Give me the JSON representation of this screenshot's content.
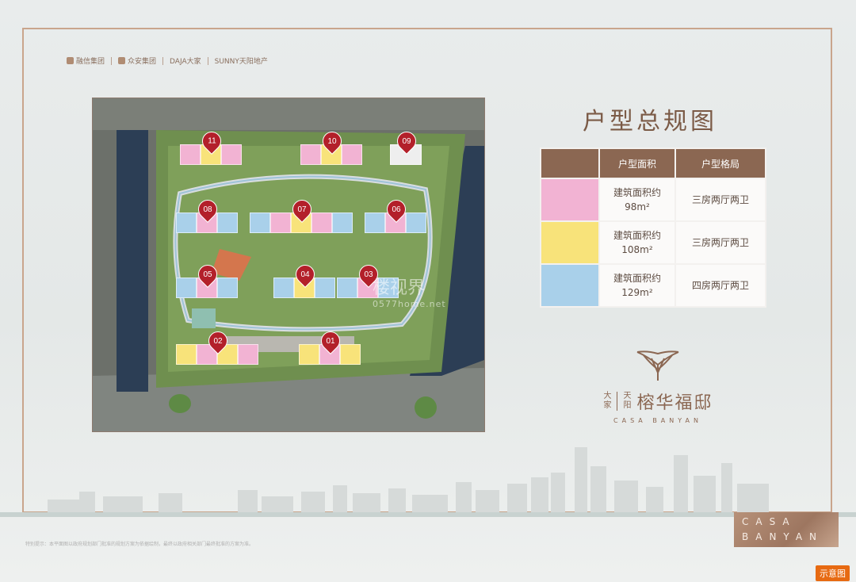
{
  "brands": [
    "融信集团",
    "众安集团",
    "DAJA大家",
    "SUNNY天阳地产"
  ],
  "title": "户型总规图",
  "table": {
    "headers": [
      "",
      "户型面积",
      "户型格局"
    ],
    "rows": [
      {
        "swatch_color": "#f2b3d3",
        "area_label": "建筑面积约",
        "area_value": "98m²",
        "layout": "三房两厅两卫"
      },
      {
        "swatch_color": "#f8e37a",
        "area_label": "建筑面积约",
        "area_value": "108m²",
        "layout": "三房两厅两卫"
      },
      {
        "swatch_color": "#a9d0ea",
        "area_label": "建筑面积约",
        "area_value": "129m²",
        "layout": "四房两厅两卫"
      }
    ]
  },
  "buildings": [
    "11",
    "10",
    "09",
    "08",
    "07",
    "06",
    "05",
    "04",
    "03",
    "02",
    "01"
  ],
  "watermark": {
    "cn": "楼视界",
    "url": "0577home.net"
  },
  "brandmark": {
    "prefix_top": "大家",
    "prefix_bottom": "天阳",
    "name": "榕华福邸",
    "english": "CASA BANYAN"
  },
  "disclaimer": "特别提示：本平面图以政府规划部门批准的规划方案为依据绘制，最终以政府相关部门最终批准的方案为准。",
  "corner_label": {
    "line1": "CASA",
    "line2": "BANYAN"
  },
  "tag": "示意图"
}
